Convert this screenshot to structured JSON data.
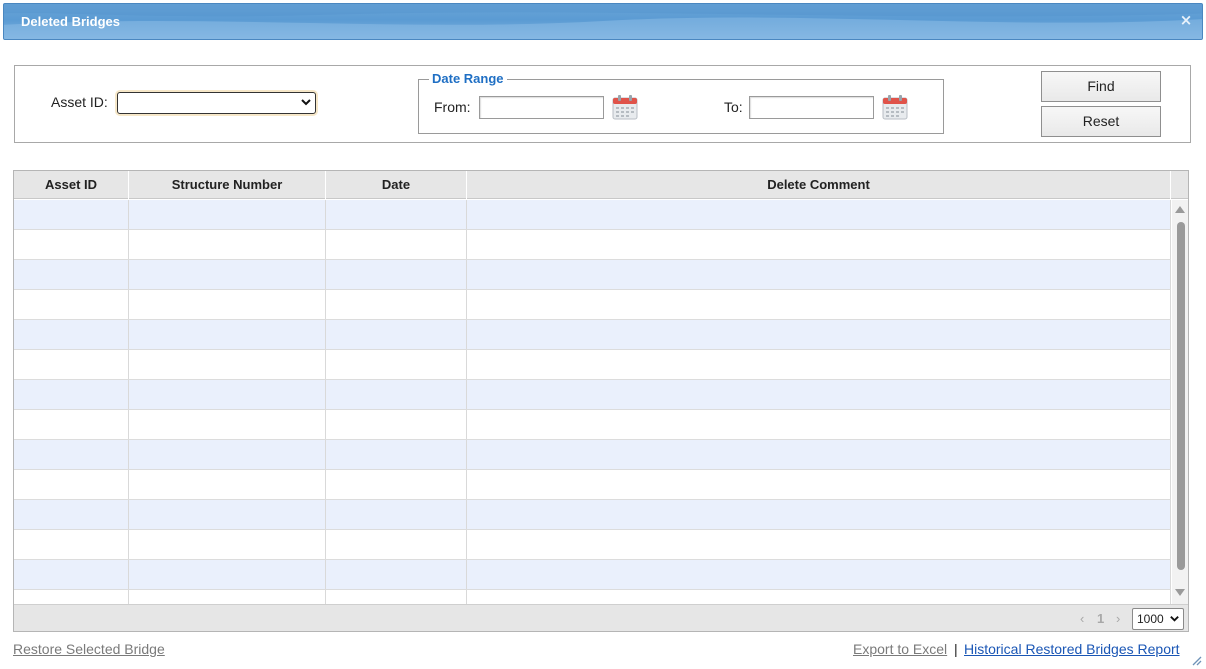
{
  "window": {
    "title": "Deleted Bridges",
    "close_glyph": "×"
  },
  "filters": {
    "asset_id_label": "Asset ID:",
    "asset_id_value": "",
    "date_range_legend": "Date Range",
    "from_label": "From:",
    "from_value": "",
    "to_label": "To:",
    "to_value": "",
    "find_label": "Find",
    "reset_label": "Reset"
  },
  "grid": {
    "columns": [
      "Asset ID",
      "Structure Number",
      "Date",
      "Delete Comment"
    ],
    "rows": [],
    "pager": {
      "prev_glyph": "‹",
      "current_page": "1",
      "next_glyph": "›",
      "page_size": "1000"
    }
  },
  "footer": {
    "restore_label": "Restore Selected Bridge",
    "export_label": "Export to Excel",
    "separator": "|",
    "history_label": "Historical Restored Bridges Report"
  },
  "colors": {
    "title_bar": "#5b9bd3",
    "legend_text": "#1f6fc4",
    "alt_row": "#eaf0fc",
    "link_active": "#1a56b5",
    "link_disabled": "#7a7a7a"
  },
  "icons": [
    "close-icon",
    "chevron-down-icon",
    "calendar-icon",
    "resize-grip-icon"
  ]
}
